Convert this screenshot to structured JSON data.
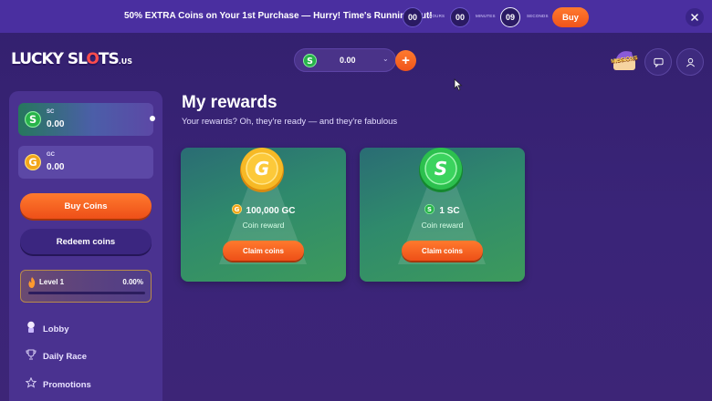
{
  "promo": {
    "text": "50% EXTRA Coins on Your 1st Purchase — Hurry! Time's Running Out!",
    "timer": [
      {
        "value": "00",
        "unit": "HOURS"
      },
      {
        "value": "00",
        "unit": "MINUTES"
      },
      {
        "value": "09",
        "unit": "SECONDS"
      }
    ],
    "buy_label": "Buy",
    "close_icon": "close-icon"
  },
  "header": {
    "logo": {
      "part1": "LUCKY SL",
      "o": "O",
      "part2": "TS",
      "tld": ".US"
    },
    "balance": {
      "amount": "0.00",
      "currency_icon": "sc-coin-icon"
    },
    "missions_label": "MISSIONS",
    "icons": [
      "missions-icon",
      "chat-icon",
      "user-icon"
    ]
  },
  "sidebar": {
    "wallets": [
      {
        "label": "SC",
        "value": "0.00",
        "icon": "sc-coin-icon"
      },
      {
        "label": "GC",
        "value": "0.00",
        "icon": "gc-coin-icon"
      }
    ],
    "buy_label": "Buy Coins",
    "redeem_label": "Redeem coins",
    "level": {
      "name": "Level 1",
      "percent": "0.00%",
      "progress": 0.0
    },
    "nav": [
      {
        "label": "Lobby",
        "icon": "lobby-icon"
      },
      {
        "label": "Daily Race",
        "icon": "trophy-icon"
      },
      {
        "label": "Promotions",
        "icon": "star-icon"
      }
    ]
  },
  "main": {
    "title": "My rewards",
    "subtitle": "Your rewards? Oh, they're ready — and they're fabulous",
    "rewards": [
      {
        "amount": "100,000 GC",
        "sub": "Coin reward",
        "button": "Claim coins",
        "coin": "gc",
        "coin_letter": "G"
      },
      {
        "amount": "1 SC",
        "sub": "Coin reward",
        "button": "Claim coins",
        "coin": "sc",
        "coin_letter": "S"
      }
    ]
  },
  "colors": {
    "accent_orange": "#f0541a",
    "background": "#33206e",
    "sc_green": "#27b34a",
    "gc_gold": "#f2a51a"
  }
}
